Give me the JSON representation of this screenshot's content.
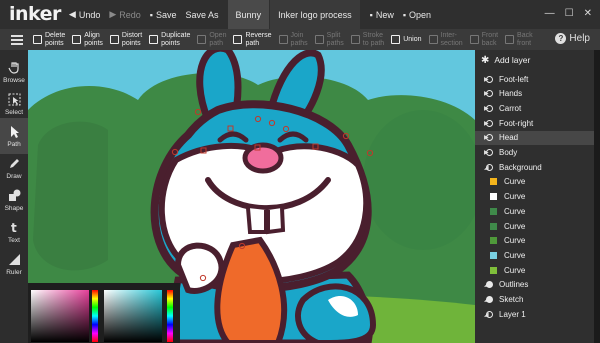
{
  "app": {
    "logo": "inker"
  },
  "titlebar": {
    "undo": "Undo",
    "redo": "Redo",
    "save": "Save",
    "save_as": "Save As",
    "tabs": [
      "Bunny",
      "Inker logo process"
    ],
    "new": "New",
    "open": "Open",
    "window_controls": [
      "minimize-icon",
      "maximize-icon",
      "close-icon"
    ]
  },
  "toolbar": {
    "ops": [
      {
        "label": "Delete\npoints",
        "enabled": true
      },
      {
        "label": "Align\npoints",
        "enabled": true
      },
      {
        "label": "Distort\npoints",
        "enabled": true
      },
      {
        "label": "Duplicate\npoints",
        "enabled": true
      },
      {
        "label": "Open\npath",
        "enabled": false
      },
      {
        "label": "Reverse\npath",
        "enabled": true
      },
      {
        "label": "Join\npaths",
        "enabled": false
      },
      {
        "label": "Split\npaths",
        "enabled": false
      },
      {
        "label": "Stroke\nto path",
        "enabled": false
      },
      {
        "label": "Union",
        "enabled": true
      },
      {
        "label": "Inter-\nsection",
        "enabled": false
      },
      {
        "label": "Front\nback",
        "enabled": false
      },
      {
        "label": "Back\nfront",
        "enabled": false
      }
    ],
    "help": "Help"
  },
  "tools": [
    {
      "label": "Browse",
      "icon": "browse-icon",
      "active": false
    },
    {
      "label": "Select",
      "icon": "select-icon",
      "active": false
    },
    {
      "label": "Path",
      "icon": "path-cursor-icon",
      "active": true
    },
    {
      "label": "Draw",
      "icon": "pencil-icon",
      "active": false
    },
    {
      "label": "Shape",
      "icon": "shape-icon",
      "active": false
    },
    {
      "label": "Text",
      "icon": "text-icon",
      "active": false
    },
    {
      "label": "Ruler",
      "icon": "ruler-icon",
      "active": false
    }
  ],
  "layers": {
    "add_label": "Add layer",
    "items": [
      {
        "name": "Foot-left",
        "kind": "group",
        "expanded": false,
        "eye": "open"
      },
      {
        "name": "Hands",
        "kind": "group",
        "expanded": false,
        "eye": "open"
      },
      {
        "name": "Carrot",
        "kind": "group",
        "expanded": false,
        "eye": "open"
      },
      {
        "name": "Foot-right",
        "kind": "group",
        "expanded": false,
        "eye": "open"
      },
      {
        "name": "Head",
        "kind": "group",
        "expanded": false,
        "eye": "open",
        "selected": true
      },
      {
        "name": "Body",
        "kind": "group",
        "expanded": false,
        "eye": "open"
      },
      {
        "name": "Background",
        "kind": "group",
        "expanded": true,
        "eye": "open"
      },
      {
        "name": "Curve",
        "kind": "curve",
        "color": "#f5b51c"
      },
      {
        "name": "Curve",
        "kind": "curve",
        "color": "#ffffff"
      },
      {
        "name": "Curve",
        "kind": "curve",
        "color": "#3f8a4a"
      },
      {
        "name": "Curve",
        "kind": "curve",
        "color": "#3f8a4a"
      },
      {
        "name": "Curve",
        "kind": "curve",
        "color": "#4f9a3a"
      },
      {
        "name": "Curve",
        "kind": "curve",
        "color": "#79d0e2"
      },
      {
        "name": "Curve",
        "kind": "curve",
        "color": "#7fbf3a"
      },
      {
        "name": "Outlines",
        "kind": "group",
        "expanded": true,
        "eye": "filled"
      },
      {
        "name": "Sketch",
        "kind": "group",
        "expanded": true,
        "eye": "filled"
      },
      {
        "name": "Layer 1",
        "kind": "group",
        "expanded": true,
        "eye": "open"
      }
    ]
  },
  "colors": {
    "sky": "#62c7de",
    "bush": "#3e8945",
    "bunny": "#1aa6c9",
    "outline": "#4a1f2e",
    "carrot": "#ef6a2a",
    "nose": "#f06d9c"
  }
}
